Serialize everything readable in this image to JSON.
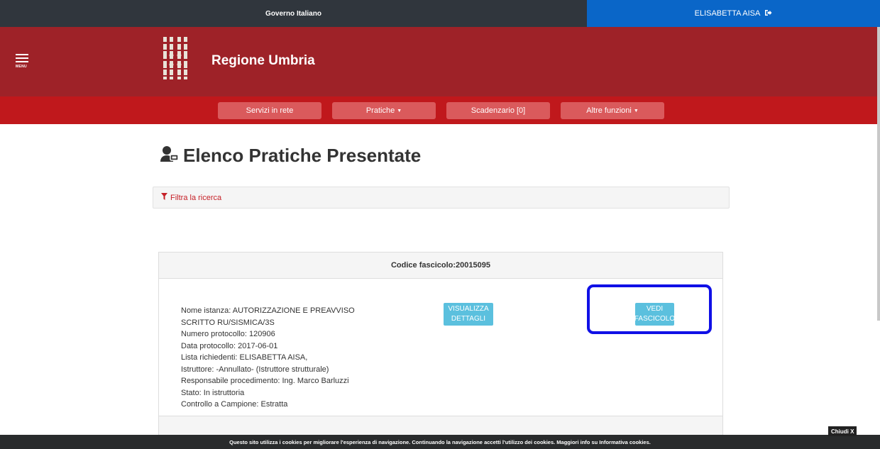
{
  "topbar": {
    "gov_label": "Governo Italiano",
    "user_label": "ELISABETTA AISA"
  },
  "header": {
    "menu_label": "MENU",
    "brand": "Regione Umbria"
  },
  "nav": {
    "items": [
      {
        "label": "Servizi in rete"
      },
      {
        "label": "Pratiche"
      },
      {
        "label": "Scadenzario [0]"
      },
      {
        "label": "Altre funzioni"
      }
    ]
  },
  "page": {
    "title": "Elenco Pratiche Presentate",
    "filter_label": "Filtra la ricerca"
  },
  "card": {
    "header": "Codice fascicolo:20015095",
    "details": [
      "Nome istanza: AUTORIZZAZIONE E PREAVVISO",
      "SCRITTO RU/SISMICA/3S",
      "Numero protocollo: 120906",
      "Data protocollo: 2017-06-01",
      "Lista richiedenti: ELISABETTA AISA,",
      "Istruttore: -Annullato- (Istruttore strutturale)",
      "Responsabile procedimento: Ing. Marco Barluzzi",
      "Stato: In istruttoria",
      "Controllo a Campione: Estratta"
    ],
    "btn_visualizza_line1": "VISUALIZZA",
    "btn_visualizza_line2": "DETTAGLI",
    "btn_vedi_line1": "VEDI",
    "btn_vedi_line2": "FASCICOLO"
  },
  "cookie": {
    "text": "Questo sito utilizza i cookies per migliorare l'esperienza di navigazione. Continuando la navigazione accetti l'utilizzo dei cookies. Maggiori info su ",
    "link": "Informativa cookies",
    "suffix": ".",
    "close_label": "Chiudi X"
  },
  "colors": {
    "topbar_dark": "#30363d",
    "topbar_blue": "#0a66c8",
    "header_red": "#9e2228",
    "nav_red": "#c0181c",
    "nav_button": "#da5a5c",
    "info_button": "#5bc0de",
    "highlight": "#1010e6",
    "filter_text": "#c62128"
  }
}
